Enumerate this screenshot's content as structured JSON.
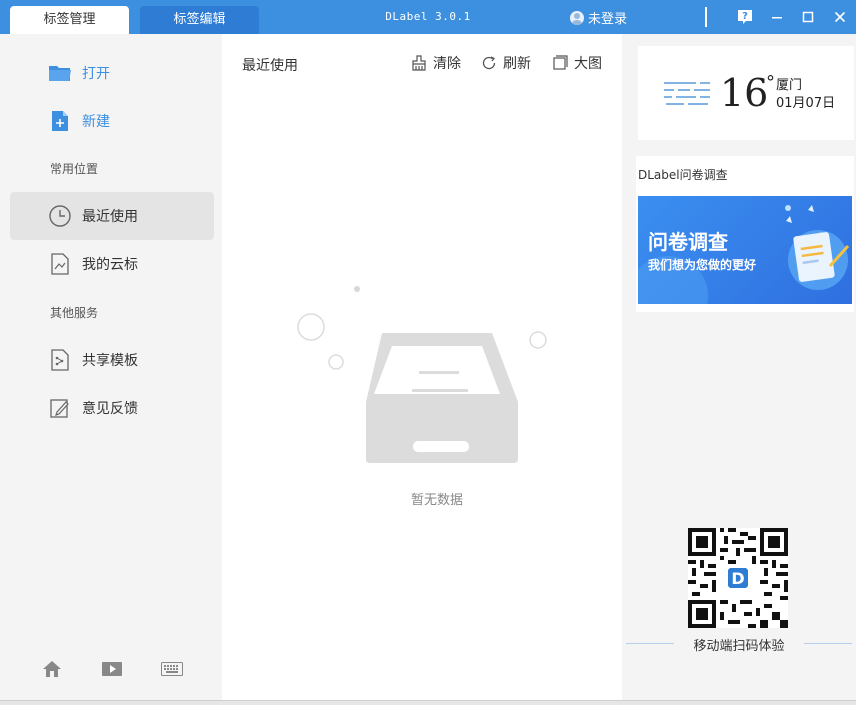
{
  "titlebar": {
    "tabs": [
      {
        "label": "标签管理",
        "active": true
      },
      {
        "label": "标签编辑",
        "active": false
      }
    ],
    "app_title": "DLabel 3.0.1",
    "login_label": "未登录",
    "icons": [
      "help-icon",
      "minimize-icon",
      "maximize-icon",
      "close-icon"
    ]
  },
  "sidebar": {
    "primary_items": [
      {
        "label": "打开",
        "icon": "folder-icon"
      },
      {
        "label": "新建",
        "icon": "new-file-icon"
      }
    ],
    "section_common": "常用位置",
    "common_items": [
      {
        "label": "最近使用",
        "icon": "clock-icon",
        "selected": true
      },
      {
        "label": "我的云标",
        "icon": "cloud-label-icon",
        "selected": false
      }
    ],
    "section_other": "其他服务",
    "other_items": [
      {
        "label": "共享模板",
        "icon": "shared-template-icon"
      },
      {
        "label": "意见反馈",
        "icon": "feedback-edit-icon"
      }
    ],
    "bottom_icons": [
      "home-icon",
      "video-play-icon",
      "keyboard-icon"
    ]
  },
  "main": {
    "title": "最近使用",
    "tools": [
      {
        "label": "清除",
        "icon": "broom-icon"
      },
      {
        "label": "刷新",
        "icon": "refresh-icon"
      },
      {
        "label": "大图",
        "icon": "large-view-icon"
      }
    ],
    "empty_text": "暂无数据"
  },
  "right": {
    "weather": {
      "temperature": "16",
      "unit": "°",
      "city": "厦门",
      "date": "01月07日",
      "icon": "fog-weather-icon"
    },
    "survey_label": "DLabel问卷调查",
    "banner_title": "问卷调查",
    "banner_subtitle": "我们想为您做的更好",
    "qr_caption": "移动端扫码体验"
  },
  "colors": {
    "accent": "#3d8fe0",
    "sidebar_bg": "#f4f4f4",
    "selected_bg": "#e4e4e4"
  }
}
